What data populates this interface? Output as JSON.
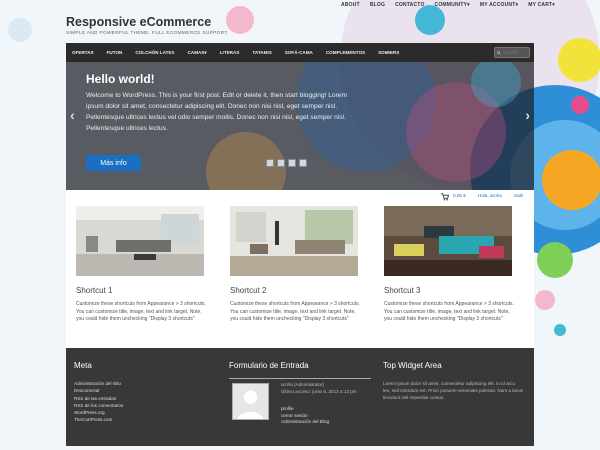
{
  "colors": {
    "accent": "#1a6fc1",
    "nav_bg": "#2b2b2b",
    "footer_bg": "#383838"
  },
  "top_menu": [
    "ABOUT",
    "BLOG",
    "CONTACTO",
    "COMMUNITY▾",
    "MY ACCOUNT▾",
    "MY CART▾"
  ],
  "site": {
    "title": "Responsive eCommerce",
    "tagline": "SIMPLE AND POWERFUL THEME. FULL ECOMMERCE SUPPORT."
  },
  "nav": {
    "items": [
      "OFERTAS",
      "FUTON",
      "COLCHÓN LATEX",
      "CAMAS▾",
      "LITERAS",
      "TATAMIS",
      "SOFÁ-CAMA",
      "COMPLEMENTOS",
      "SOMIERS"
    ],
    "search_placeholder": "Search",
    "search_icon": "search-icon"
  },
  "slider": {
    "title": "Hello world!",
    "text": "Welcome to WordPress. This is your first post. Edit or delete it, then start blogging! Lorem ipsum dolor sit amet, consectetur adipiscing elit. Donec non nisi nisl, eget semper nisl. Pellentesque ultrices lectus vel odio semper mollis. Donec non nisi nisl, eget semper nisl. Pellentesque ultrices lectus.",
    "button": "Más info",
    "prev": "‹",
    "next": "›"
  },
  "cartbar": {
    "cart_icon": "cart-icon",
    "amount": "0,00 €",
    "greeting": "Hola, aroha",
    "logout": "Salir"
  },
  "shortcuts": [
    {
      "title": "Shortcut 1",
      "text": "Customize these shortcuts from Appearance > 3 shortcuts. You can customize title, image, text and link target. Note, you could hide them unchecking \"Display 3 shortcuts\""
    },
    {
      "title": "Shortcut 2",
      "text": "Customize these shortcuts from Appearance > 3 shortcuts. You can customize title, image, text and link target. Note, you could hide them unchecking \"Display 3 shortcuts\""
    },
    {
      "title": "Shortcut 3",
      "text": "Customize these shortcuts from Appearance > 3 shortcuts. You can customize title, image, text and link target. Note, you could hide them unchecking \"Display 3 shortcuts\""
    }
  ],
  "footer": {
    "meta": {
      "title": "Meta",
      "links": [
        "Administración del sitio",
        "Desconectar",
        "RSS de las entradas",
        "RSS de los comentarios",
        "WordPress.org",
        "TheCartPress.com"
      ]
    },
    "form": {
      "title": "Formulario de Entrada",
      "user": "aroha (Administrator)",
      "last_access": "Último acceso: junio 6, 2013 4:13 pm",
      "links": [
        "profile",
        "cerrar sesión",
        "Administración del Blog"
      ]
    },
    "widget": {
      "title": "Top Widget Area",
      "text": "Lorem ipsum dolor sit amet, consectetur adipiscing elit. In id arcu leo, sed interdum est. Proin posuere venenatis pulvinar. Nam a lacus tincidunt nisl imperdiet cursus."
    }
  }
}
